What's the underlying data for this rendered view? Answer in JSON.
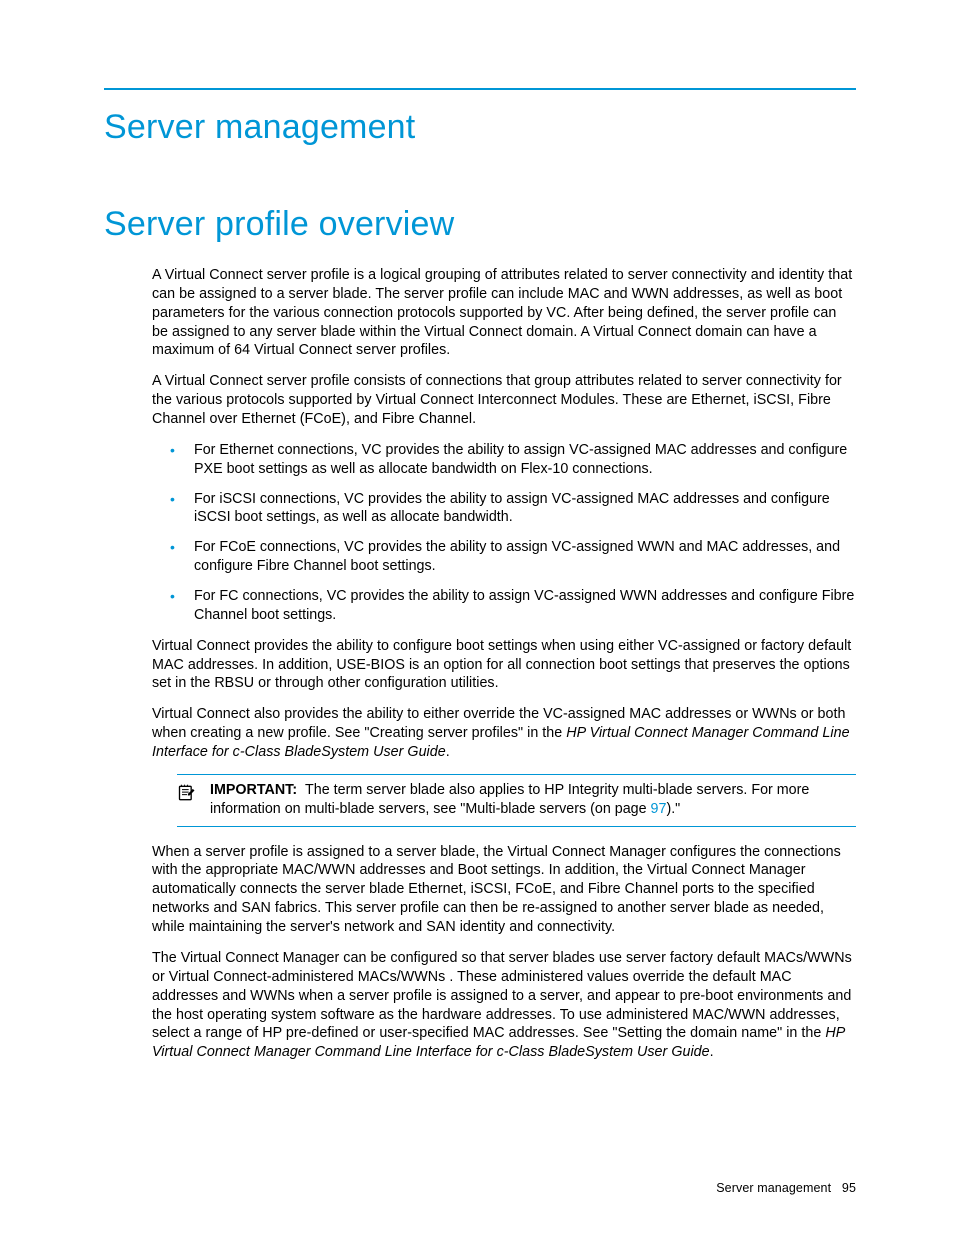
{
  "headings": {
    "h1": "Server management",
    "h2": "Server profile overview"
  },
  "paragraphs": {
    "p1": "A Virtual Connect server profile is a logical grouping of attributes related to server connectivity and identity that can be assigned to a server blade. The server profile can include MAC and WWN addresses, as well as boot parameters for the various connection protocols supported by VC. After being defined, the server profile can be assigned to any server blade within the Virtual Connect domain. A Virtual Connect domain can have a maximum of 64 Virtual Connect server profiles.",
    "p2": "A Virtual Connect server profile consists of connections that group attributes related to server connectivity for the various protocols supported by Virtual Connect Interconnect Modules. These are Ethernet, iSCSI, Fibre Channel over Ethernet (FCoE), and Fibre Channel.",
    "p3": "Virtual Connect provides the ability to configure boot settings when using either VC-assigned or factory default MAC addresses. In addition, USE-BIOS is an option for all connection boot settings that preserves the options set in the RBSU or through other configuration utilities.",
    "p4a": "Virtual Connect also provides the ability to either override the VC-assigned MAC addresses or WWNs or both when creating a new profile. See \"Creating server profiles\" in the ",
    "p4b": "HP Virtual Connect Manager Command Line Interface for c-Class BladeSystem User Guide",
    "p4c": ".",
    "p5": "When a server profile is assigned to a server blade, the Virtual Connect Manager configures the connections with the appropriate MAC/WWN addresses and Boot settings. In addition, the Virtual Connect Manager automatically connects the server blade Ethernet, iSCSI, FCoE, and Fibre Channel ports to the specified networks and SAN fabrics. This server profile can then be re-assigned to another server blade as needed, while maintaining the server's network and SAN identity and connectivity.",
    "p6a": "The Virtual Connect Manager can be configured so that server blades use server factory default MACs/WWNs or Virtual Connect-administered MACs/WWNs . These administered values override the default MAC addresses and WWNs when a server profile is assigned to a server, and appear to pre-boot environments and the host operating system software as the hardware addresses. To use administered MAC/WWN addresses, select a range of HP pre-defined or user-specified MAC addresses. See \"Setting the domain name\" in the ",
    "p6b": "HP Virtual Connect Manager Command Line Interface for c-Class BladeSystem User Guide",
    "p6c": "."
  },
  "bullets": [
    "For Ethernet connections, VC provides the ability to assign VC-assigned MAC addresses and configure PXE boot settings as well as allocate bandwidth on Flex-10 connections.",
    "For iSCSI connections, VC provides the ability to assign VC-assigned MAC addresses and configure iSCSI boot settings, as well as allocate bandwidth.",
    "For FCoE connections, VC provides the ability to assign VC-assigned WWN and MAC addresses, and configure Fibre Channel boot settings.",
    "For FC connections, VC provides the ability to assign VC-assigned WWN addresses and configure Fibre Channel boot settings."
  ],
  "note": {
    "label": "IMPORTANT:",
    "text_a": "The term server blade also applies to HP Integrity multi-blade servers. For more information on multi-blade servers, see \"Multi-blade servers (on page ",
    "link": "97",
    "text_b": ").\""
  },
  "footer": {
    "section": "Server management",
    "page": "95"
  }
}
